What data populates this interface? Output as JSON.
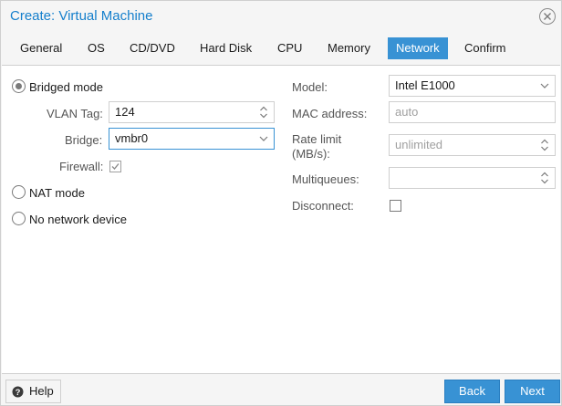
{
  "window": {
    "title": "Create: Virtual Machine"
  },
  "tabs": [
    {
      "label": "General"
    },
    {
      "label": "OS"
    },
    {
      "label": "CD/DVD"
    },
    {
      "label": "Hard Disk"
    },
    {
      "label": "CPU"
    },
    {
      "label": "Memory"
    },
    {
      "label": "Network",
      "active": true
    },
    {
      "label": "Confirm"
    }
  ],
  "left": {
    "bridged_mode": {
      "label": "Bridged mode",
      "checked": true
    },
    "vlan_tag": {
      "label": "VLAN Tag:",
      "value": "124"
    },
    "bridge": {
      "label": "Bridge:",
      "value": "vmbr0"
    },
    "firewall": {
      "label": "Firewall:",
      "checked": true
    },
    "nat_mode": {
      "label": "NAT mode",
      "checked": false
    },
    "no_network": {
      "label": "No network device",
      "checked": false
    }
  },
  "right": {
    "model": {
      "label": "Model:",
      "value": "Intel E1000"
    },
    "mac": {
      "label": "MAC address:",
      "placeholder": "auto"
    },
    "rate_limit": {
      "label_line1": "Rate limit",
      "label_line2": "(MB/s):",
      "placeholder": "unlimited"
    },
    "multiqueues": {
      "label": "Multiqueues:",
      "value": ""
    },
    "disconnect": {
      "label": "Disconnect:",
      "checked": false
    }
  },
  "footer": {
    "help_label": "Help",
    "back_label": "Back",
    "next_label": "Next"
  },
  "colors": {
    "accent": "#3892d4",
    "title": "#157fcc"
  }
}
